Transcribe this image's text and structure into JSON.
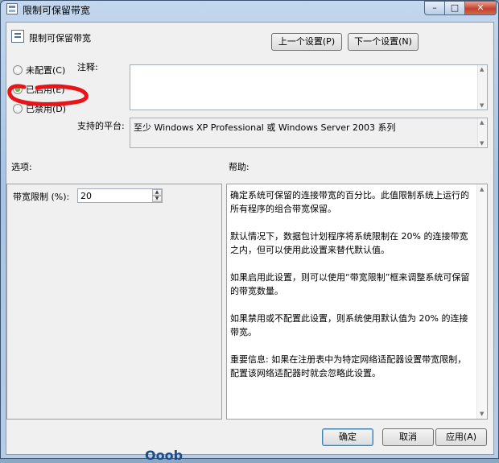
{
  "window": {
    "title": "限制可保留带宽"
  },
  "header": {
    "title": "限制可保留带宽",
    "prev_label": "上一个设置(P)",
    "next_label": "下一个设置(N)"
  },
  "state": {
    "not_configured": "未配置(C)",
    "enabled": "已启用(E)",
    "disabled": "已禁用(D)",
    "selected": "enabled"
  },
  "comment": {
    "label": "注释:",
    "value": ""
  },
  "platform": {
    "label": "支持的平台:",
    "value": "至少 Windows XP Professional 或 Windows Server 2003 系列"
  },
  "options": {
    "title": "选项:",
    "bandwidth_label": "带宽限制 (%):",
    "bandwidth_value": "20"
  },
  "help": {
    "title": "帮助:",
    "paragraphs": [
      "确定系统可保留的连接带宽的百分比。此值限制系统上运行的所有程序的组合带宽保留。",
      "默认情况下，数据包计划程序将系统限制在 20% 的连接带宽之内，但可以使用此设置来替代默认值。",
      "如果启用此设置，则可以使用“带宽限制”框来调整系统可保留的带宽数量。",
      "如果禁用或不配置此设置，则系统使用默认值为 20% 的连接带宽。",
      "重要信息: 如果在注册表中为特定网络适配器设置带宽限制，配置该网络适配器时就会忽略此设置。"
    ]
  },
  "footer": {
    "ok_label": "确定",
    "cancel_label": "取消",
    "apply_label": "应用(A)"
  },
  "watermark": "Ooob",
  "colors": {
    "annotation": "#e8141a",
    "title_bar": "#a8c4e3",
    "close_button": "#c4412c"
  }
}
